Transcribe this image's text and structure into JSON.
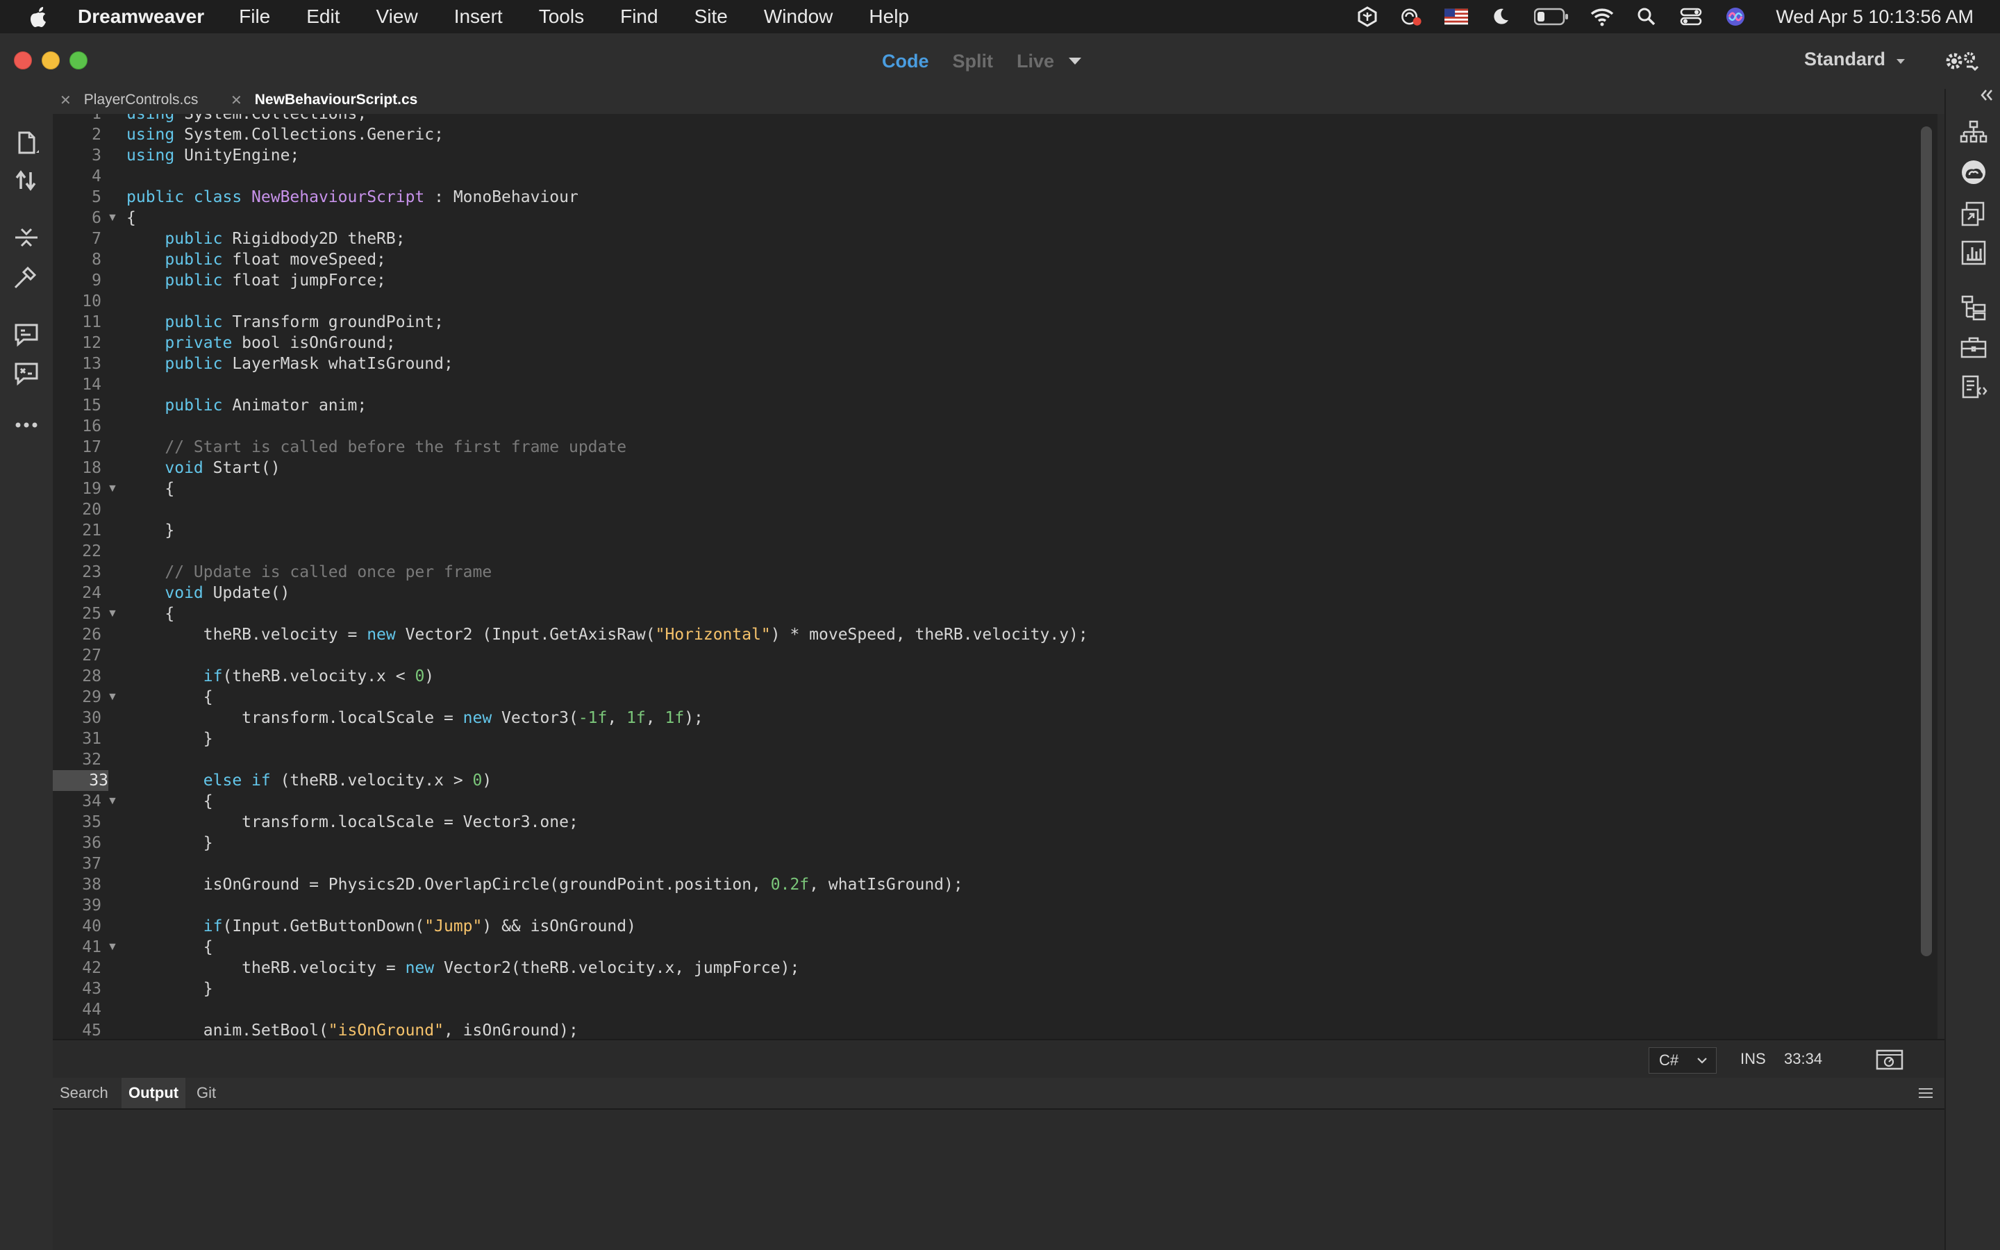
{
  "menubar": {
    "app_name": "Dreamweaver",
    "items": [
      "File",
      "Edit",
      "View",
      "Insert",
      "Tools",
      "Find",
      "Site",
      "Window",
      "Help"
    ],
    "clock": "Wed Apr 5  10:13:56 AM"
  },
  "titlebar": {
    "views": [
      "Code",
      "Split",
      "Live"
    ],
    "active_view": "Code",
    "workspace": "Standard"
  },
  "tabs": [
    {
      "label": "PlayerControls.cs",
      "active": false
    },
    {
      "label": "NewBehaviourScript.cs",
      "active": true
    }
  ],
  "editor": {
    "current_line": 33,
    "lines": [
      {
        "n": "1",
        "fold": false,
        "tokens": [
          [
            "kw",
            "using"
          ],
          [
            "plain",
            " System.Collections;"
          ]
        ]
      },
      {
        "n": "2",
        "fold": false,
        "tokens": [
          [
            "kw",
            "using"
          ],
          [
            "plain",
            " System.Collections.Generic;"
          ]
        ]
      },
      {
        "n": "3",
        "fold": false,
        "tokens": [
          [
            "kw",
            "using"
          ],
          [
            "plain",
            " UnityEngine;"
          ]
        ]
      },
      {
        "n": "4",
        "fold": false,
        "tokens": []
      },
      {
        "n": "5",
        "fold": false,
        "tokens": [
          [
            "kw",
            "public class"
          ],
          [
            "plain",
            " "
          ],
          [
            "type",
            "NewBehaviourScript"
          ],
          [
            "plain",
            " : MonoBehaviour"
          ]
        ]
      },
      {
        "n": "6",
        "fold": true,
        "tokens": [
          [
            "plain",
            "{"
          ]
        ]
      },
      {
        "n": "7",
        "fold": false,
        "tokens": [
          [
            "plain",
            "    "
          ],
          [
            "kw",
            "public"
          ],
          [
            "plain",
            " Rigidbody2D theRB;"
          ]
        ]
      },
      {
        "n": "8",
        "fold": false,
        "tokens": [
          [
            "plain",
            "    "
          ],
          [
            "kw",
            "public"
          ],
          [
            "plain",
            " float moveSpeed;"
          ]
        ]
      },
      {
        "n": "9",
        "fold": false,
        "tokens": [
          [
            "plain",
            "    "
          ],
          [
            "kw",
            "public"
          ],
          [
            "plain",
            " float jumpForce;"
          ]
        ]
      },
      {
        "n": "10",
        "fold": false,
        "tokens": []
      },
      {
        "n": "11",
        "fold": false,
        "tokens": [
          [
            "plain",
            "    "
          ],
          [
            "kw",
            "public"
          ],
          [
            "plain",
            " Transform groundPoint;"
          ]
        ]
      },
      {
        "n": "12",
        "fold": false,
        "tokens": [
          [
            "plain",
            "    "
          ],
          [
            "kw",
            "private"
          ],
          [
            "plain",
            " bool isOnGround;"
          ]
        ]
      },
      {
        "n": "13",
        "fold": false,
        "tokens": [
          [
            "plain",
            "    "
          ],
          [
            "kw",
            "public"
          ],
          [
            "plain",
            " LayerMask whatIsGround;"
          ]
        ]
      },
      {
        "n": "14",
        "fold": false,
        "tokens": []
      },
      {
        "n": "15",
        "fold": false,
        "tokens": [
          [
            "plain",
            "    "
          ],
          [
            "kw",
            "public"
          ],
          [
            "plain",
            " Animator anim;"
          ]
        ]
      },
      {
        "n": "16",
        "fold": false,
        "tokens": []
      },
      {
        "n": "17",
        "fold": false,
        "tokens": [
          [
            "plain",
            "    "
          ],
          [
            "cmt",
            "// Start is called before the first frame update"
          ]
        ]
      },
      {
        "n": "18",
        "fold": false,
        "tokens": [
          [
            "plain",
            "    "
          ],
          [
            "kw",
            "void"
          ],
          [
            "plain",
            " Start()"
          ]
        ]
      },
      {
        "n": "19",
        "fold": true,
        "tokens": [
          [
            "plain",
            "    {"
          ]
        ]
      },
      {
        "n": "20",
        "fold": false,
        "tokens": []
      },
      {
        "n": "21",
        "fold": false,
        "tokens": [
          [
            "plain",
            "    }"
          ]
        ]
      },
      {
        "n": "22",
        "fold": false,
        "tokens": []
      },
      {
        "n": "23",
        "fold": false,
        "tokens": [
          [
            "plain",
            "    "
          ],
          [
            "cmt",
            "// Update is called once per frame"
          ]
        ]
      },
      {
        "n": "24",
        "fold": false,
        "tokens": [
          [
            "plain",
            "    "
          ],
          [
            "kw",
            "void"
          ],
          [
            "plain",
            " Update()"
          ]
        ]
      },
      {
        "n": "25",
        "fold": true,
        "tokens": [
          [
            "plain",
            "    {"
          ]
        ]
      },
      {
        "n": "26",
        "fold": false,
        "tokens": [
          [
            "plain",
            "        theRB.velocity = "
          ],
          [
            "kw",
            "new"
          ],
          [
            "plain",
            " Vector2 (Input.GetAxisRaw("
          ],
          [
            "str",
            "\"Horizontal\""
          ],
          [
            "plain",
            ") * moveSpeed, theRB.velocity.y);"
          ]
        ]
      },
      {
        "n": "27",
        "fold": false,
        "tokens": []
      },
      {
        "n": "28",
        "fold": false,
        "tokens": [
          [
            "plain",
            "        "
          ],
          [
            "kw",
            "if"
          ],
          [
            "plain",
            "(theRB.velocity.x < "
          ],
          [
            "num",
            "0"
          ],
          [
            "plain",
            ")"
          ]
        ]
      },
      {
        "n": "29",
        "fold": true,
        "tokens": [
          [
            "plain",
            "        {"
          ]
        ]
      },
      {
        "n": "30",
        "fold": false,
        "tokens": [
          [
            "plain",
            "            transform.localScale = "
          ],
          [
            "kw",
            "new"
          ],
          [
            "plain",
            " Vector3("
          ],
          [
            "num",
            "-1f"
          ],
          [
            "plain",
            ", "
          ],
          [
            "num",
            "1f"
          ],
          [
            "plain",
            ", "
          ],
          [
            "num",
            "1f"
          ],
          [
            "plain",
            ");"
          ]
        ]
      },
      {
        "n": "31",
        "fold": false,
        "tokens": [
          [
            "plain",
            "        }"
          ]
        ]
      },
      {
        "n": "32",
        "fold": false,
        "tokens": []
      },
      {
        "n": "33",
        "fold": false,
        "tokens": [
          [
            "plain",
            "        "
          ],
          [
            "kw",
            "else if"
          ],
          [
            "plain",
            " (theRB.velocity.x > "
          ],
          [
            "num",
            "0"
          ],
          [
            "plain",
            ")"
          ]
        ]
      },
      {
        "n": "34",
        "fold": true,
        "tokens": [
          [
            "plain",
            "        {"
          ]
        ]
      },
      {
        "n": "35",
        "fold": false,
        "tokens": [
          [
            "plain",
            "            transform.localScale = Vector3.one;"
          ]
        ]
      },
      {
        "n": "36",
        "fold": false,
        "tokens": [
          [
            "plain",
            "        }"
          ]
        ]
      },
      {
        "n": "37",
        "fold": false,
        "tokens": []
      },
      {
        "n": "38",
        "fold": false,
        "tokens": [
          [
            "plain",
            "        isOnGround = Physics2D.OverlapCircle(groundPoint.position, "
          ],
          [
            "num",
            "0.2f"
          ],
          [
            "plain",
            ", whatIsGround);"
          ]
        ]
      },
      {
        "n": "39",
        "fold": false,
        "tokens": []
      },
      {
        "n": "40",
        "fold": false,
        "tokens": [
          [
            "plain",
            "        "
          ],
          [
            "kw",
            "if"
          ],
          [
            "plain",
            "(Input.GetButtonDown("
          ],
          [
            "str",
            "\"Jump\""
          ],
          [
            "plain",
            ") && isOnGround)"
          ]
        ]
      },
      {
        "n": "41",
        "fold": true,
        "tokens": [
          [
            "plain",
            "        {"
          ]
        ]
      },
      {
        "n": "42",
        "fold": false,
        "tokens": [
          [
            "plain",
            "            theRB.velocity = "
          ],
          [
            "kw",
            "new"
          ],
          [
            "plain",
            " Vector2(theRB.velocity.x, jumpForce);"
          ]
        ]
      },
      {
        "n": "43",
        "fold": false,
        "tokens": [
          [
            "plain",
            "        }"
          ]
        ]
      },
      {
        "n": "44",
        "fold": false,
        "tokens": []
      },
      {
        "n": "45",
        "fold": false,
        "tokens": [
          [
            "plain",
            "        anim.SetBool("
          ],
          [
            "str",
            "\"isOnGround\""
          ],
          [
            "plain",
            ", isOnGround);"
          ]
        ]
      }
    ]
  },
  "statusbar": {
    "language": "C#",
    "mode": "INS",
    "cursor": "33:34"
  },
  "bottom_panel": {
    "tabs": [
      "Search",
      "Output",
      "Git"
    ],
    "active_tab": "Output"
  },
  "colors": {
    "accent": "#4a9de0",
    "keyword": "#63c6ea",
    "type": "#c792ea",
    "string": "#f5c26b",
    "number": "#7bc77a",
    "comment": "#7a7a7a"
  }
}
